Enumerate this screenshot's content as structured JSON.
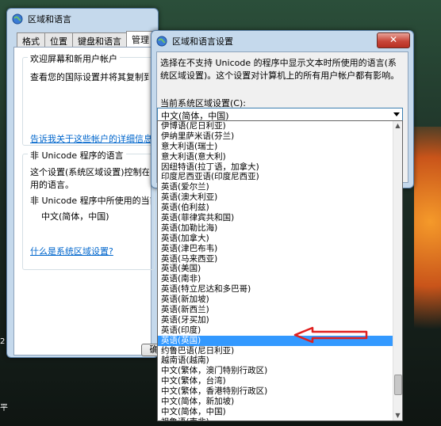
{
  "back_window": {
    "title": "区域和语言",
    "tabs": [
      "格式",
      "位置",
      "键盘和语言",
      "管理"
    ],
    "welcome_group": {
      "legend": "欢迎屏幕和新用户帐户",
      "text": "查看您的国际设置并将其复制到欢迎屏",
      "link": "告诉我关于这些帐户的详细信息"
    },
    "nonunicode_group": {
      "legend": "非 Unicode 程序的语言",
      "text1": "这个设置(系统区域设置)控制在不支持",
      "text1b": "用的语言。",
      "text2": "非 Unicode 程序中所使用的当前语言:",
      "current": "中文(简体，中国)",
      "link": "什么是系统区域设置?"
    },
    "ok_partial": "确"
  },
  "front_window": {
    "title": "区域和语言设置",
    "description": "选择在不支持 Unicode 的程序中显示文本时所使用的语言(系统区域设置)。这个设置对计算机上的所有用户帐户都有影响。",
    "current_label": "当前系统区域设置(C):",
    "combo_value": "中文(简体，中国)"
  },
  "dropdown_items": [
    "伊博语(尼日利亚)",
    "伊纳里萨米语(芬兰)",
    "意大利语(瑞士)",
    "意大利语(意大利)",
    "因纽特语(拉丁语，加拿大)",
    "印度尼西亚语(印度尼西亚)",
    "英语(爱尔兰)",
    "英语(澳大利亚)",
    "英语(伯利兹)",
    "英语(菲律宾共和国)",
    "英语(加勒比海)",
    "英语(加拿大)",
    "英语(津巴布韦)",
    "英语(马来西亚)",
    "英语(美国)",
    "英语(南非)",
    "英语(特立尼达和多巴哥)",
    "英语(新加坡)",
    "英语(新西兰)",
    "英语(牙买加)",
    "英语(印度)",
    "英语(英国)",
    "约鲁巴语(尼日利亚)",
    "越南语(越南)",
    "中文(繁体，澳门特别行政区)",
    "中文(繁体，台湾)",
    "中文(繁体，香港特别行政区)",
    "中文(简体，新加坡)",
    "中文(简体，中国)",
    "祖鲁语(南非)"
  ],
  "selected_item": "英语(英国)",
  "desktop": {
    "partial_text": "平",
    "partial_digit": "2"
  },
  "colors": {
    "selection": "#3399ff",
    "annotation_arrow": "#e0201f",
    "link": "#0066cc"
  }
}
